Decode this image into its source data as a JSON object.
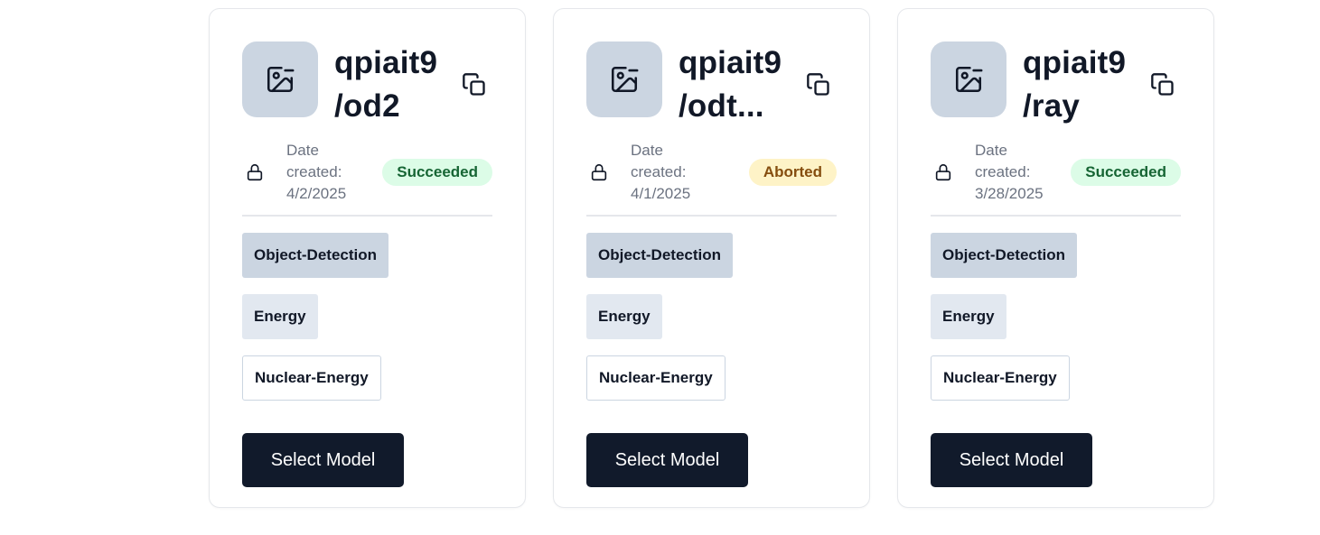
{
  "models": [
    {
      "title_line1": "qpiait9",
      "title_line2": "/od2",
      "date_label": "Date created:",
      "date_value": "4/2/2025",
      "status": "Succeeded",
      "status_type": "success",
      "tags": [
        "Object-Detection",
        "Energy",
        "Nuclear-Energy"
      ],
      "button_label": "Select Model"
    },
    {
      "title_line1": "qpiait9",
      "title_line2": "/odt...",
      "date_label": "Date created:",
      "date_value": "4/1/2025",
      "status": "Aborted",
      "status_type": "aborted",
      "tags": [
        "Object-Detection",
        "Energy",
        "Nuclear-Energy"
      ],
      "button_label": "Select Model"
    },
    {
      "title_line1": "qpiait9",
      "title_line2": "/ray",
      "date_label": "Date created:",
      "date_value": "3/28/2025",
      "status": "Succeeded",
      "status_type": "success",
      "tags": [
        "Object-Detection",
        "Energy",
        "Nuclear-Energy"
      ],
      "button_label": "Select Model"
    }
  ],
  "colors": {
    "thumb_bg": "#cbd5e1",
    "success_bg": "#dcfce7",
    "success_text": "#166534",
    "aborted_bg": "#fef3c7",
    "aborted_text": "#854d0e",
    "button_bg": "#111a2b"
  },
  "icons": {
    "thumbnail": "image-icon",
    "copy": "copy-icon",
    "visibility": "lock-icon"
  }
}
